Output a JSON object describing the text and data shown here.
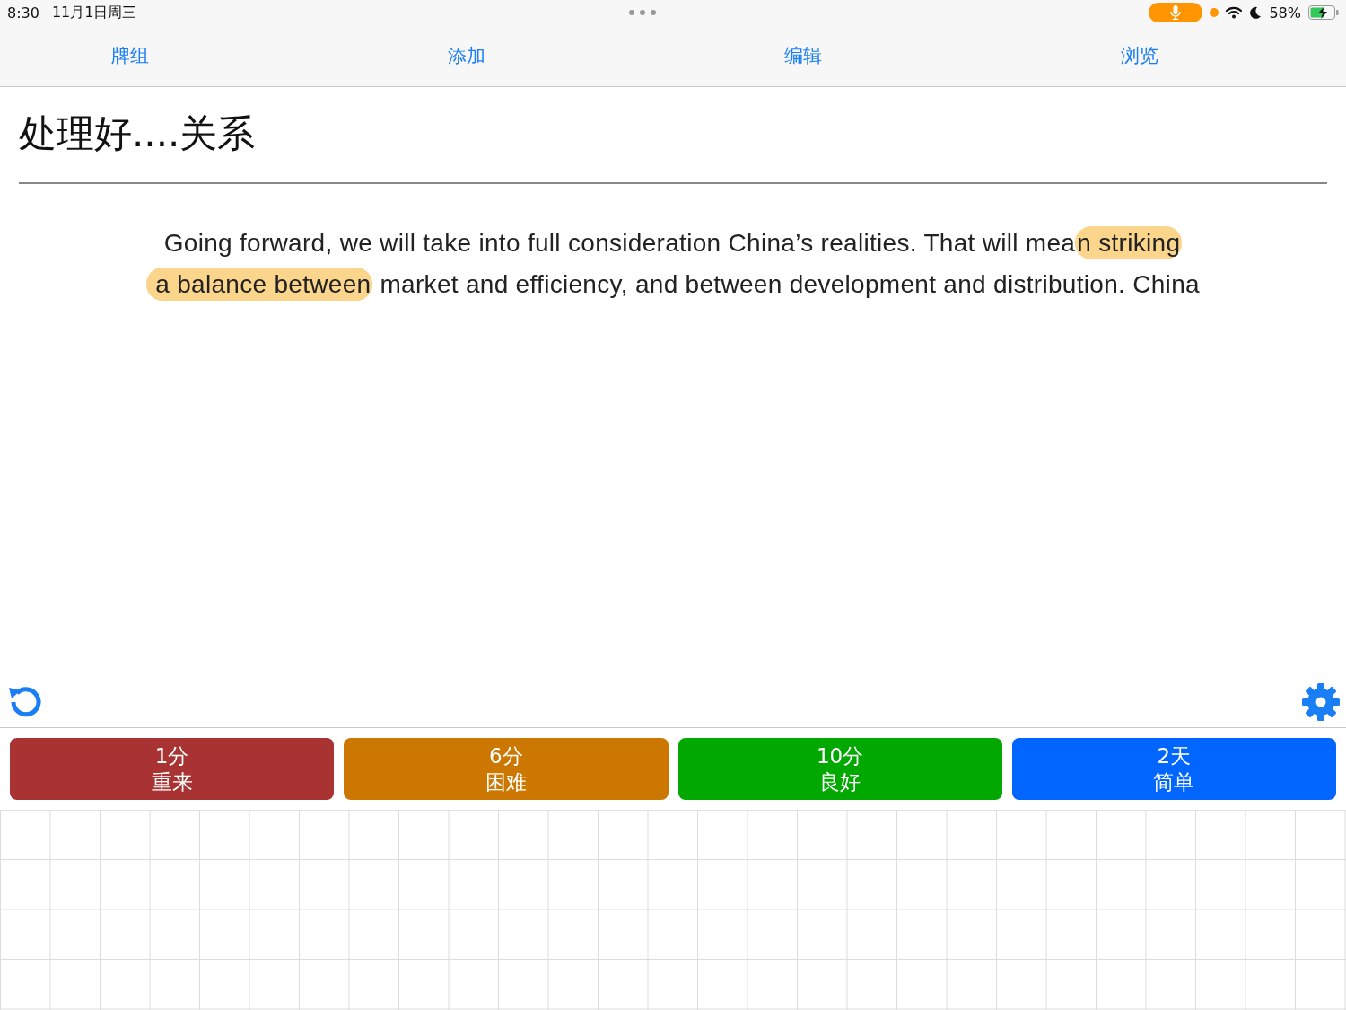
{
  "status_bar": {
    "time": "8:30",
    "date": "11月1日周三",
    "battery": "58%"
  },
  "tabs": [
    {
      "label": "牌组"
    },
    {
      "label": "添加"
    },
    {
      "label": "编辑"
    },
    {
      "label": "浏览"
    }
  ],
  "card": {
    "question": "处理好....关系",
    "passage": [
      {
        "segments": [
          {
            "text": "Going forward, we will take into full consideration China’s realities. That will mea",
            "highlighted": false
          },
          {
            "text": "n striking",
            "highlighted": true
          }
        ]
      },
      {
        "segments": [
          {
            "text": " a balance between",
            "highlighted": true
          },
          {
            "text": " market and efficiency, and between development and distribution. China",
            "highlighted": false
          }
        ]
      }
    ]
  },
  "answer_buttons": [
    {
      "interval": "1分",
      "label": "重来",
      "color": "#a93232"
    },
    {
      "interval": "6分",
      "label": "困难",
      "color": "#cc7700"
    },
    {
      "interval": "10分",
      "label": "良好",
      "color": "#00a800"
    },
    {
      "interval": "2天",
      "label": "简单",
      "color": "#0066ff"
    }
  ]
}
